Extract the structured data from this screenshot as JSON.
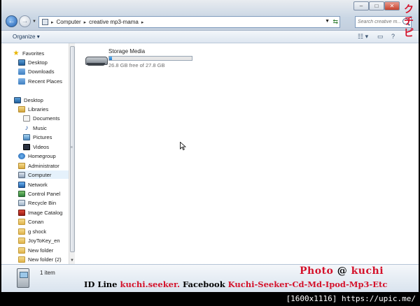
{
  "address": {
    "crumbs": [
      "Computer",
      "creative mp3-mama"
    ]
  },
  "search": {
    "placeholder": "Search creative m..."
  },
  "toolbar": {
    "organize_label": "Organize"
  },
  "sidebar": {
    "favorites": {
      "label": "Favorites",
      "items": [
        "Desktop",
        "Downloads",
        "Recent Places"
      ]
    },
    "desktop": {
      "label": "Desktop"
    },
    "libraries": {
      "label": "Libraries",
      "items": [
        "Documents",
        "Music",
        "Pictures",
        "Videos"
      ]
    },
    "other": [
      "Homegroup",
      "Administrator",
      "Computer",
      "Network",
      "Control Panel",
      "Recycle Bin",
      "Image Catalog",
      "Conan",
      "g shock",
      "JoyToKey_en",
      "New folder",
      "New folder (2)"
    ]
  },
  "drive": {
    "name": "Storage Media",
    "free_text": "26.8 GB free of 27.8 GB",
    "used_fraction": 0.036
  },
  "status": {
    "count_text": "1 item"
  },
  "watermark": {
    "photo_text": "Photo",
    "at_sign": "@",
    "kuchi_text": "kuchi",
    "id_line_label": "ID Line",
    "id_line_value": "kuchi.seeker.",
    "facebook_label": "Facebook",
    "facebook_value": "Kuchi-Seeker-Cd-Md-Ipod-Mp3-Etc",
    "vertical_chars": [
      "ク",
      "チ",
      "ピ"
    ],
    "upic_text": "[1600x1116] https://upic.me/"
  }
}
